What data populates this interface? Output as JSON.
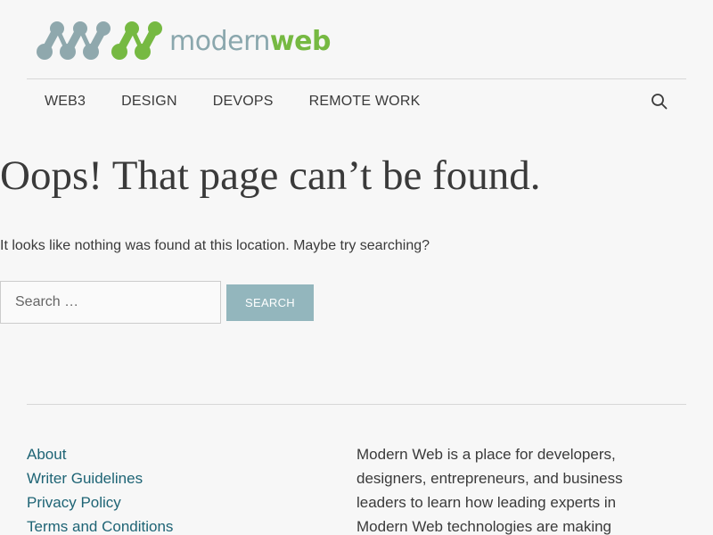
{
  "logo": {
    "text_modern": "modern",
    "text_web": "web",
    "icon": "modernweb-molecule-logo",
    "colors": {
      "grey": "#8fa8ad",
      "green": "#76b942"
    }
  },
  "nav": {
    "items": [
      {
        "label": "WEB3"
      },
      {
        "label": "DESIGN"
      },
      {
        "label": "DEVOPS"
      },
      {
        "label": "REMOTE WORK"
      }
    ],
    "search_icon": "search-icon"
  },
  "main": {
    "title": "Oops! That page can’t be found.",
    "notice": "It looks like nothing was found at this location. Maybe try searching?",
    "search": {
      "placeholder": "Search …",
      "value": "",
      "button_label": "SEARCH"
    }
  },
  "footer": {
    "links": [
      {
        "label": "About"
      },
      {
        "label": "Writer Guidelines"
      },
      {
        "label": "Privacy Policy"
      },
      {
        "label": "Terms and Conditions"
      }
    ],
    "about_text": "Modern Web is a place for developers, designers, entrepreneurs, and business leaders to learn how leading experts in Modern Web technologies are making"
  },
  "colors": {
    "link": "#1e6475",
    "button": "#93b6bd",
    "accent_green": "#76b942",
    "accent_grey": "#8fa8ad"
  }
}
